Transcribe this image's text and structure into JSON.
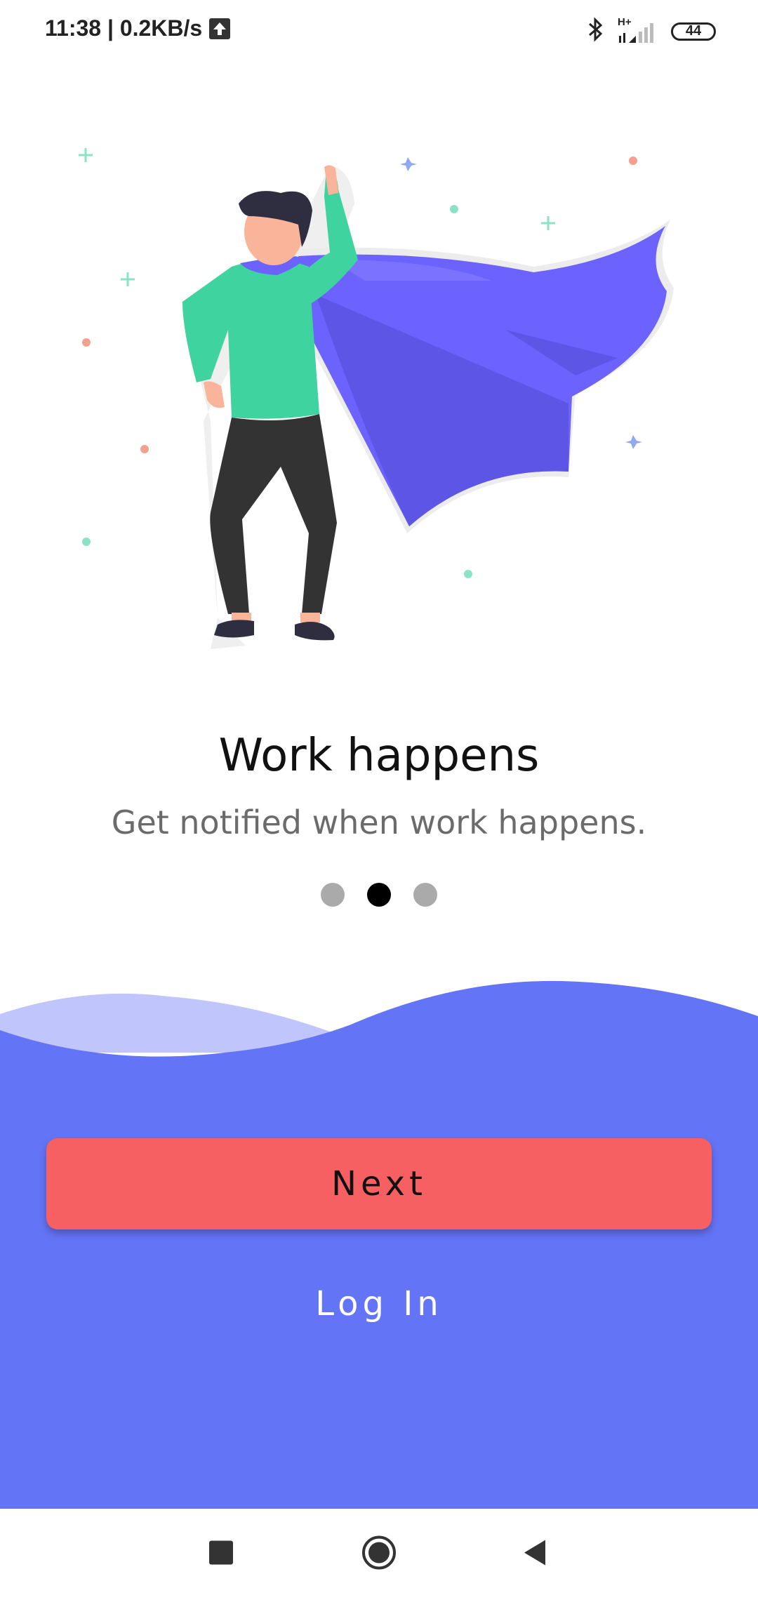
{
  "status_bar": {
    "time_speed": "11:38 | 0.2KB/s",
    "network_label": "H+",
    "battery_level": "44"
  },
  "onboarding": {
    "title": "Work happens",
    "subtitle": "Get notified when work happens.",
    "page_count": 3,
    "active_page": 2
  },
  "actions": {
    "next_label": "Next",
    "login_label": "Log In"
  },
  "colors": {
    "primary_blue": "#6474f6",
    "light_wave": "#c0c5fb",
    "next_button": "#f76063",
    "cape": "#6c63ff",
    "shirt": "#3fd3a0"
  },
  "icons": {
    "status_upload": "upload-arrow-icon",
    "bluetooth": "bluetooth-icon",
    "signal": "signal-icon",
    "battery": "battery-icon",
    "nav_recents": "square-icon",
    "nav_home": "circle-icon",
    "nav_back": "triangle-back-icon"
  }
}
